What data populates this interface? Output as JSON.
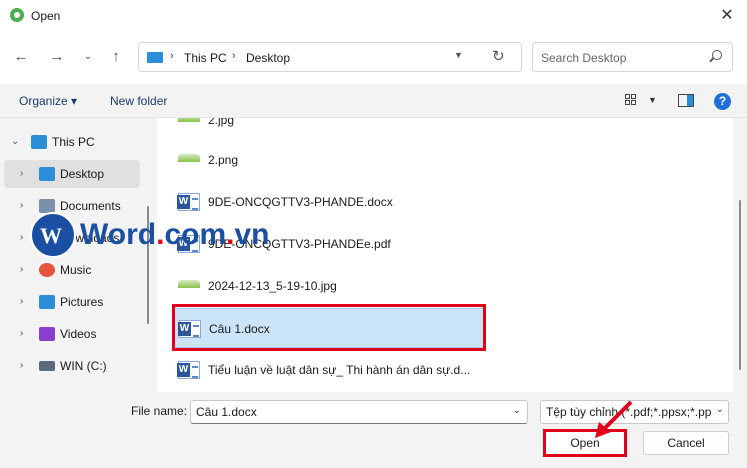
{
  "window": {
    "title": "Open",
    "close_glyph": "✕"
  },
  "nav": {
    "back_glyph": "←",
    "forward_glyph": "→",
    "recent_glyph": "⌄",
    "up_glyph": "↑",
    "breadcrumb": [
      "This PC",
      "Desktop"
    ],
    "refresh_glyph": "↻",
    "search_placeholder": "Search Desktop"
  },
  "commandbar": {
    "organize": "Organize ▾",
    "new_folder": "New folder",
    "help": "?"
  },
  "sidebar": {
    "items": [
      {
        "label": "This PC",
        "icon": "monitor-icon",
        "color": "#2a8fd8"
      },
      {
        "label": "Desktop",
        "icon": "desktop-icon",
        "color": "#2a8fd8"
      },
      {
        "label": "Documents",
        "icon": "documents-icon",
        "color": "#7a8fa8"
      },
      {
        "label": "Downloads",
        "icon": "downloads-icon",
        "color": "#2e9e5e"
      },
      {
        "label": "Music",
        "icon": "music-icon",
        "color": "#e2553a"
      },
      {
        "label": "Pictures",
        "icon": "pictures-icon",
        "color": "#2a8fd8"
      },
      {
        "label": "Videos",
        "icon": "videos-icon",
        "color": "#8a3fd1"
      },
      {
        "label": "WIN (C:)",
        "icon": "drive-icon",
        "color": "#5a6b7d"
      }
    ]
  },
  "files": [
    {
      "name": "2.jpg",
      "type": "image"
    },
    {
      "name": "2.png",
      "type": "image"
    },
    {
      "name": "9DE-ONCQGTTV3-PHANDE.docx",
      "type": "word"
    },
    {
      "name": "9DE-ONCQGTTV3-PHANDEe.pdf",
      "type": "word"
    },
    {
      "name": "2024-12-13_5-19-10.jpg",
      "type": "image"
    },
    {
      "name": "Câu 1.docx",
      "type": "word",
      "selected": true
    },
    {
      "name": "Tiểu luận về luật dân sự_ Thi hành án dân sự.d...",
      "type": "word"
    }
  ],
  "bottom": {
    "file_name_label": "File name:",
    "file_name_value": "Câu 1.docx",
    "filter_value": "Tệp tùy chỉnh (*.pdf;*.ppsx;*.pp",
    "open_label": "Open",
    "cancel_label": "Cancel"
  },
  "watermark": {
    "word": "Word",
    "dot": ".",
    "com": "com",
    "dot2": ".",
    "vn": "vn"
  },
  "colors": {
    "annotation_red": "#e2001a",
    "selection_blue": "#cce4f7",
    "accent": "#2a8fd8"
  }
}
